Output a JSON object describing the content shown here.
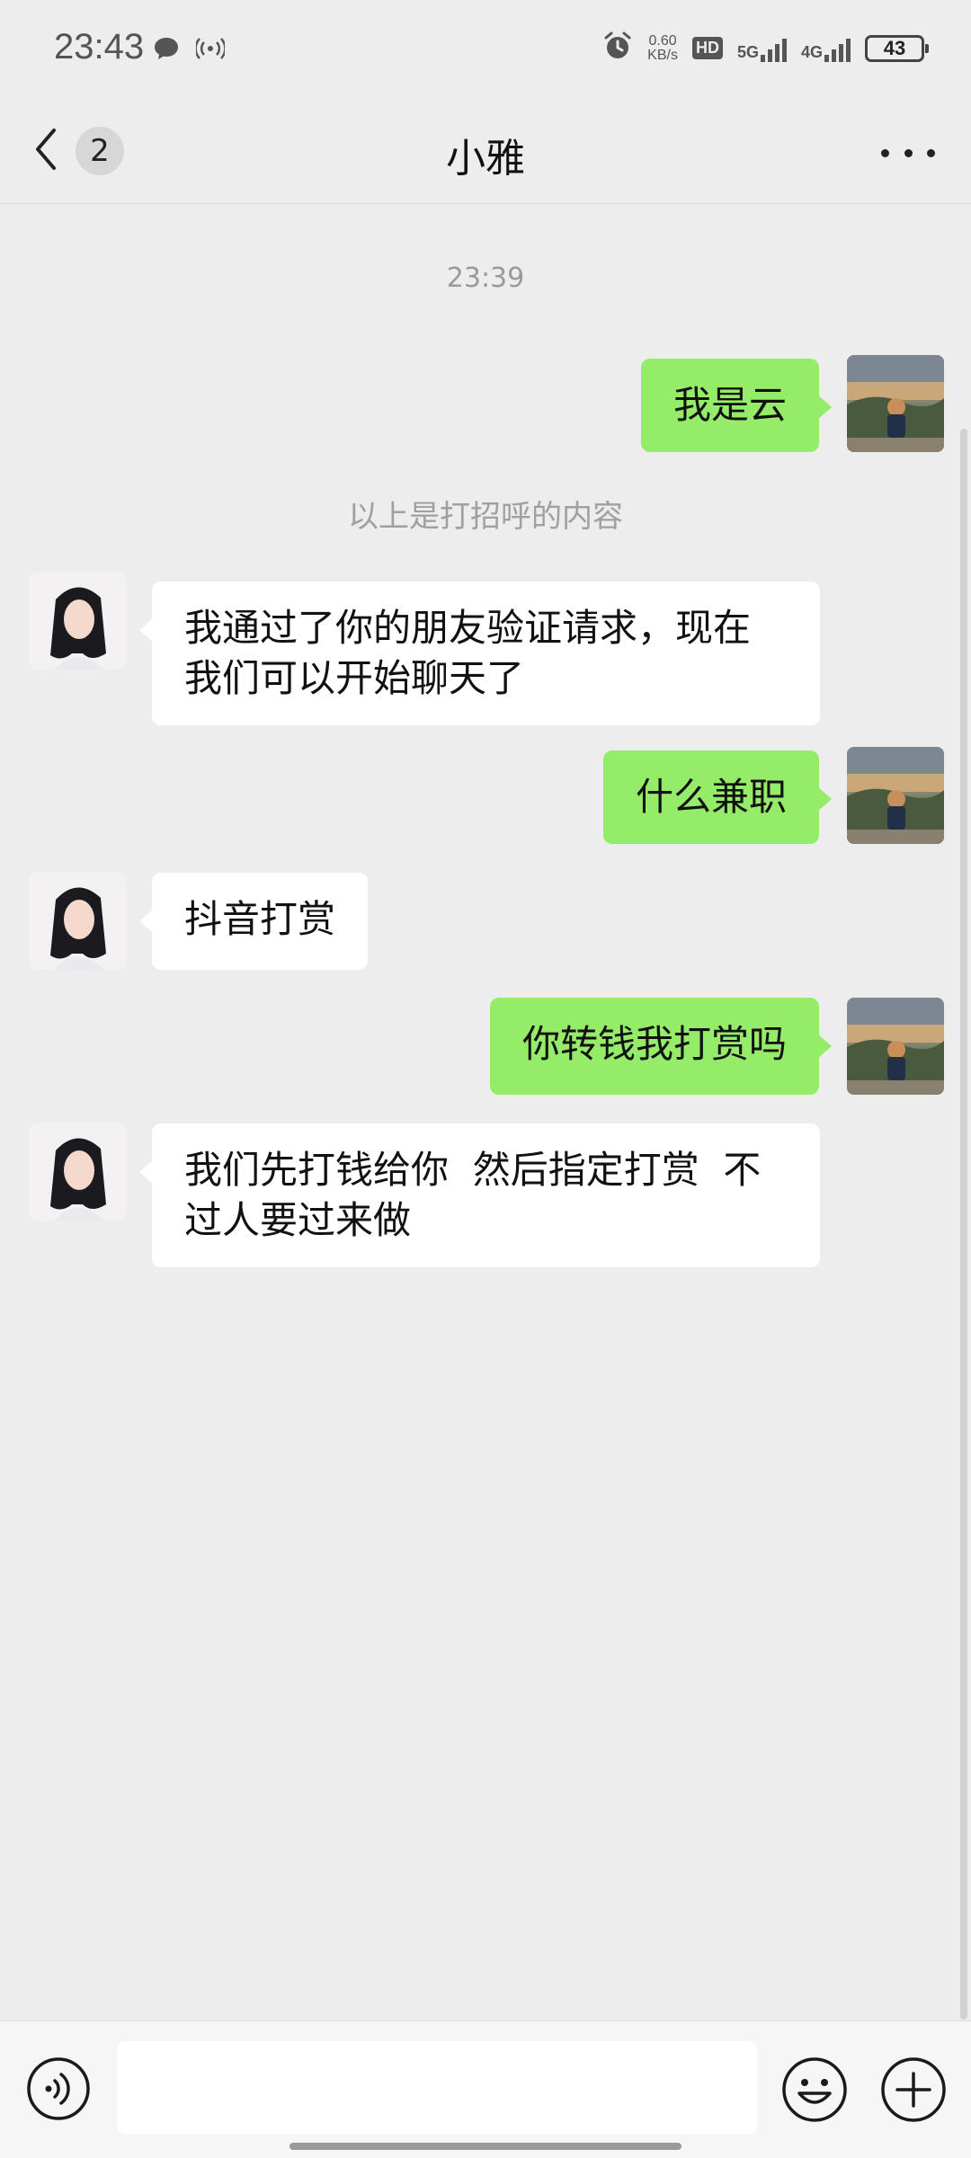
{
  "status_bar": {
    "time": "23:43",
    "net_speed_value": "0.60",
    "net_speed_unit": "KB/s",
    "hd_label": "HD",
    "sim1_label": "5G",
    "sim2_label": "4G",
    "battery": "43"
  },
  "header": {
    "unread_count": "2",
    "title": "小雅"
  },
  "chat": {
    "timestamp": "23:39",
    "system_note": "以上是打招呼的内容",
    "messages": [
      {
        "from": "me",
        "text": "我是云"
      },
      {
        "from": "contact",
        "text": "我通过了你的朋友验证请求，现在我们可以开始聊天了"
      },
      {
        "from": "me",
        "text": "什么兼职"
      },
      {
        "from": "contact",
        "text": "抖音打赏"
      },
      {
        "from": "me",
        "text": "你转钱我打赏吗"
      },
      {
        "from": "contact",
        "text": "我们先打钱给你  然后指定打赏  不过人要过来做"
      }
    ]
  },
  "input": {
    "value": "",
    "placeholder": ""
  },
  "colors": {
    "background": "#ededed",
    "my_bubble": "#95ec69",
    "contact_bubble": "#ffffff"
  },
  "icons": {
    "back": "chevron-left-icon",
    "more": "more-dots-icon",
    "voice": "voice-icon",
    "emoji": "emoji-icon",
    "plus": "plus-icon"
  }
}
